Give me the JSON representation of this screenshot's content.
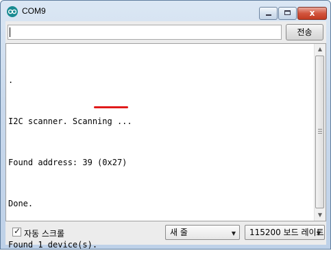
{
  "window": {
    "title": "COM9",
    "close_glyph": "x",
    "icons": {
      "app": "arduino-icon",
      "minimize": "minimize-icon",
      "maximize": "maximize-icon",
      "close": "close-icon"
    }
  },
  "input": {
    "value": "",
    "send_label": "전송"
  },
  "output": {
    "lines": [
      ".",
      "I2C scanner. Scanning ...",
      "Found address: 39 (0x27)",
      "Done.",
      "Found 1 device(s)."
    ]
  },
  "footer": {
    "autoscroll_label": "자동 스크롤",
    "autoscroll_checked": true,
    "line_ending_value": "새 줄",
    "baud_value": "115200 보드 레이트"
  },
  "colors": {
    "highlight_underline": "#e01a1a",
    "app_icon": "#1a8b92"
  }
}
